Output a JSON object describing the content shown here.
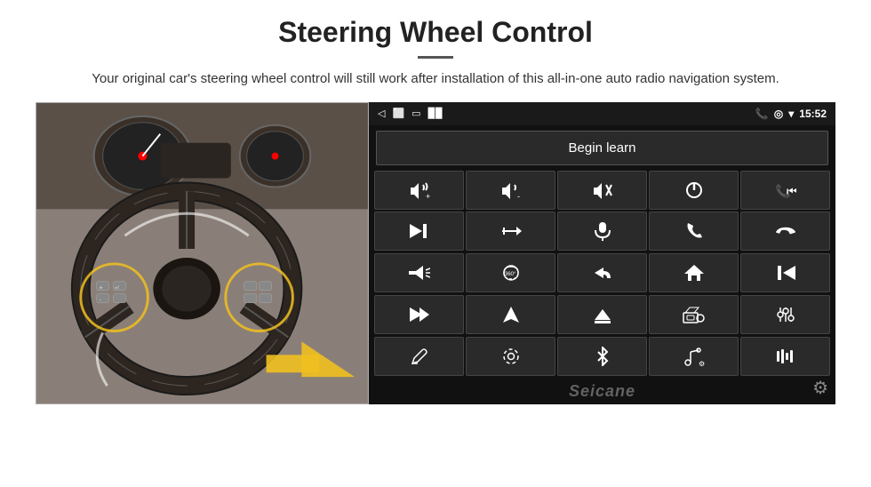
{
  "header": {
    "title": "Steering Wheel Control",
    "subtitle": "Your original car's steering wheel control will still work after installation of this all-in-one auto radio navigation system."
  },
  "status_bar": {
    "time": "15:52",
    "back_icon": "◁",
    "home_icon": "⬜",
    "recent_icon": "▭",
    "signal_icon": "📶",
    "phone_icon": "📞",
    "gps_icon": "📍",
    "wifi_icon": "▾"
  },
  "begin_learn_button": "Begin learn",
  "watermark": "Seicane",
  "grid_buttons": [
    {
      "icon": "🔊+",
      "name": "vol-up"
    },
    {
      "icon": "🔊-",
      "name": "vol-down"
    },
    {
      "icon": "🔇",
      "name": "mute"
    },
    {
      "icon": "⏻",
      "name": "power"
    },
    {
      "icon": "⏮",
      "name": "prev-track-phone"
    },
    {
      "icon": "⏭",
      "name": "next"
    },
    {
      "icon": "✂⏭",
      "name": "fast-forward"
    },
    {
      "icon": "🎤",
      "name": "mic"
    },
    {
      "icon": "📞",
      "name": "call"
    },
    {
      "icon": "📞↩",
      "name": "hang-up"
    },
    {
      "icon": "📢",
      "name": "horn"
    },
    {
      "icon": "360°",
      "name": "360-camera"
    },
    {
      "icon": "↩",
      "name": "back"
    },
    {
      "icon": "⌂",
      "name": "home"
    },
    {
      "icon": "⏮⏮",
      "name": "rewind"
    },
    {
      "icon": "⏭",
      "name": "skip-next"
    },
    {
      "icon": "➤",
      "name": "nav"
    },
    {
      "icon": "⊜",
      "name": "eject"
    },
    {
      "icon": "📻",
      "name": "radio"
    },
    {
      "icon": "⚙⚙",
      "name": "settings"
    },
    {
      "icon": "🖊",
      "name": "edit"
    },
    {
      "icon": "⚙",
      "name": "config"
    },
    {
      "icon": "✱",
      "name": "bluetooth"
    },
    {
      "icon": "🎵⚙",
      "name": "music-settings"
    },
    {
      "icon": "|||",
      "name": "equalizer"
    }
  ]
}
